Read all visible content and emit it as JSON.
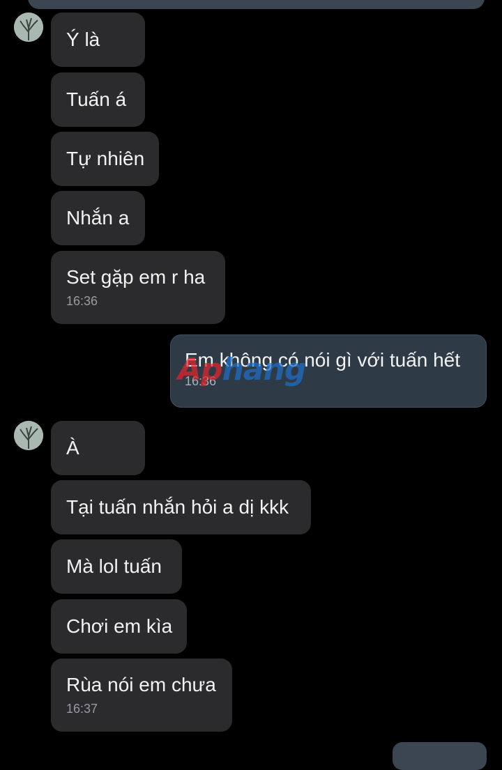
{
  "conversation": {
    "incoming_group_1": {
      "messages": [
        "Ý là",
        "Tuấn á",
        "Tự nhiên",
        "Nhắn a",
        "Set gặp em r ha"
      ],
      "time": "16:36"
    },
    "outgoing": {
      "message": "Em không có nói gì với tuấn hết",
      "time": "16:36"
    },
    "incoming_group_2": {
      "messages": [
        "À",
        "Tại tuấn nhắn hỏi a dị kkk",
        "Mà lol tuấn",
        "Chơi em kìa",
        "Rùa nói em chưa"
      ],
      "time": "16:37"
    }
  },
  "watermark": {
    "part1": "Ap",
    "part2": "hang"
  },
  "colors": {
    "background": "#000000",
    "incoming_bubble": "#2b2b2d",
    "outgoing_bubble": "#2e3a46",
    "timestamp": "#9a9aa0"
  }
}
